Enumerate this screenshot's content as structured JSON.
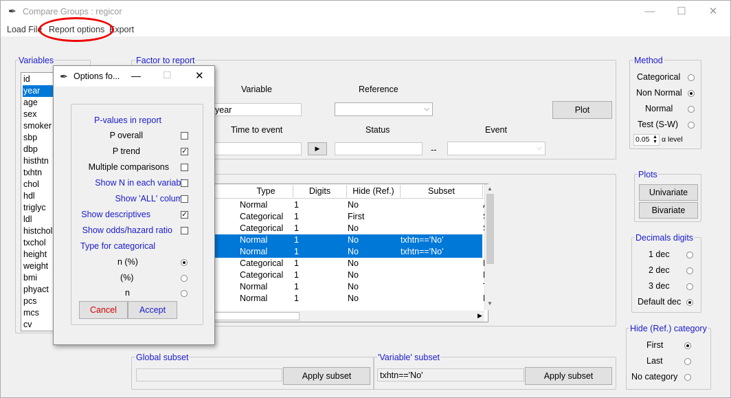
{
  "window": {
    "title": "Compare Groups : regicor",
    "controls": {
      "minimize": "—",
      "maximize": "☐",
      "close": "✕"
    }
  },
  "menu": [
    "Load File",
    "Report options",
    "Export"
  ],
  "variables": {
    "title": "Variables",
    "items": [
      "id",
      "year",
      "age",
      "sex",
      "smoker",
      "sbp",
      "dbp",
      "histhtn",
      "txhtn",
      "chol",
      "hdl",
      "triglyc",
      "ldl",
      "histchol",
      "txchol",
      "height",
      "weight",
      "bmi",
      "phyact",
      "pcs",
      "mcs",
      "cv"
    ],
    "selected": "year"
  },
  "factor": {
    "title": "Factor to report",
    "variable_label": "Variable",
    "reference_label": "Reference",
    "variable_value": "year",
    "reference_value": "",
    "plot_button": "Plot",
    "time_label": "Time to event",
    "status_label": "Status",
    "event_label": "Event",
    "time_value": "",
    "status_value": "",
    "dashes": "--",
    "play_icon": "▶",
    "event_value": ""
  },
  "table": {
    "headers": [
      "Type",
      "Digits",
      "Hide (Ref.)",
      "Subset"
    ],
    "rows": [
      {
        "type": "Normal",
        "digits": "1",
        "hide": "No",
        "subset": "",
        "extra": "A",
        "selected": false
      },
      {
        "type": "Categorical",
        "digits": "1",
        "hide": "First",
        "subset": "",
        "extra": "S",
        "selected": false
      },
      {
        "type": "Categorical",
        "digits": "1",
        "hide": "No",
        "subset": "",
        "extra": "S",
        "selected": false
      },
      {
        "type": "Normal",
        "digits": "1",
        "hide": "No",
        "subset": "txhtn=='No'",
        "extra": "S",
        "selected": true
      },
      {
        "type": "Normal",
        "digits": "1",
        "hide": "No",
        "subset": "txhtn=='No'",
        "extra": "D",
        "selected": true
      },
      {
        "type": "Categorical",
        "digits": "1",
        "hide": "No",
        "subset": "",
        "extra": "H",
        "selected": false
      },
      {
        "type": "Categorical",
        "digits": "1",
        "hide": "No",
        "subset": "",
        "extra": "H",
        "selected": false
      },
      {
        "type": "Normal",
        "digits": "1",
        "hide": "No",
        "subset": "",
        "extra": "T",
        "selected": false
      },
      {
        "type": "Normal",
        "digits": "1",
        "hide": "No",
        "subset": "",
        "extra": "H",
        "selected": false
      }
    ]
  },
  "method": {
    "title": "Method",
    "options": [
      "Categorical",
      "Non Normal",
      "Normal",
      "Test (S-W)"
    ],
    "selected": "Non Normal",
    "alpha_value": "0.05",
    "alpha_label": "α level"
  },
  "plots": {
    "title": "Plots",
    "univariate": "Univariate",
    "bivariate": "Bivariate"
  },
  "decimals": {
    "title": "Decimals digits",
    "options": [
      "1 dec",
      "2 dec",
      "3 dec",
      "Default dec"
    ],
    "selected": "Default dec"
  },
  "hide_ref": {
    "title": "Hide (Ref.) category",
    "options": [
      "First",
      "Last",
      "No category"
    ],
    "selected": "First"
  },
  "global_subset": {
    "title": "Global subset",
    "value": "",
    "button": "Apply subset"
  },
  "variable_subset": {
    "title": "'Variable' subset",
    "value": "txhtn=='No'",
    "button": "Apply subset"
  },
  "dialog": {
    "title": "Options fo...",
    "section": "P-values in report",
    "checks": [
      {
        "label": "P overall",
        "checked": false,
        "blue": false
      },
      {
        "label": "P trend",
        "checked": true,
        "blue": false
      },
      {
        "label": "Multiple comparisons",
        "checked": false,
        "blue": false
      },
      {
        "label": "Show N in each variable",
        "checked": false,
        "blue": true
      },
      {
        "label": "Show 'ALL' column",
        "checked": false,
        "blue": true
      },
      {
        "label": "Show descriptives",
        "checked": true,
        "blue": true
      },
      {
        "label": "Show odds/hazard ratio",
        "checked": false,
        "blue": true
      }
    ],
    "type_label": "Type for categorical",
    "type_options": [
      "n (%)",
      "(%)",
      "n"
    ],
    "type_selected": "n (%)",
    "cancel": "Cancel",
    "accept": "Accept"
  },
  "colors": {
    "accent": "#1a1acc",
    "selection": "#0078d7",
    "cancel": "#d40000",
    "highlight_oval": "#e00000"
  }
}
